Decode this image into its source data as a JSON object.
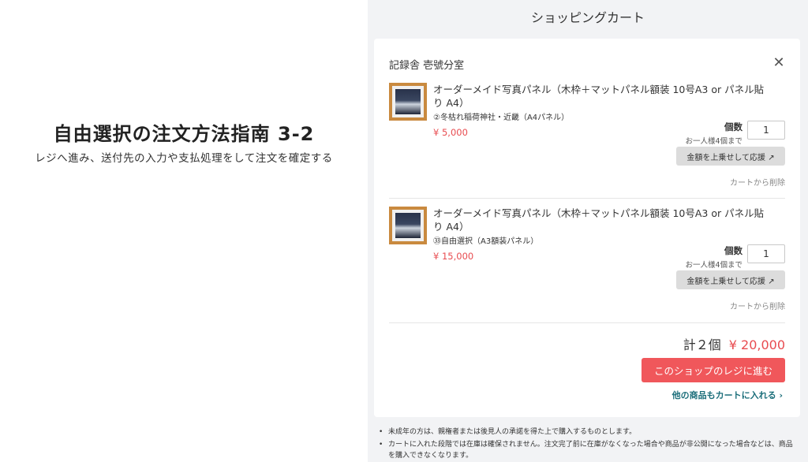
{
  "intro": {
    "headline": "自由選択の注文方法指南 3-2",
    "subtitle": "レジへ進み、送付先の入力や支払処理をして注文を確定する"
  },
  "cart": {
    "title": "ショッピングカート",
    "shop_name": "記録舎 壱號分室",
    "close_icon": "close-icon",
    "items": [
      {
        "name": "オーダーメイド写真パネル（木枠＋マットパネル額装 10号A3 or パネル貼り A4）",
        "variant": "②冬枯れ稲荷神社・近畿（A4パネル）",
        "price": "¥ 5,000",
        "qty_label": "個数",
        "qty_limit": "お一人様4個まで",
        "qty_value": "1",
        "boost_label": "金額を上乗せして応援 ↗",
        "remove_label": "カートから削除"
      },
      {
        "name": "オーダーメイド写真パネル（木枠＋マットパネル額装 10号A3 or パネル貼り A4）",
        "variant": "㉝自由選択（A3額装パネル）",
        "price": "¥ 15,000",
        "qty_label": "個数",
        "qty_limit": "お一人様4個まで",
        "qty_value": "1",
        "boost_label": "金額を上乗せして応援 ↗",
        "remove_label": "カートから削除"
      }
    ],
    "total_count": "計２個",
    "total_price": "¥ 20,000",
    "checkout_label": "このショップのレジに進む",
    "continue_label": "他の商品もカートに入れる ›",
    "notes": [
      "未成年の方は、親権者または後見人の承諾を得た上で購入するものとします。",
      "カートに入れた段階では在庫は確保されません。注文完了前に在庫がなくなった場合や商品が非公開になった場合などは、商品を購入できなくなります。"
    ],
    "colors": {
      "accent": "#f0575b",
      "price": "#e84c50",
      "link": "#1b6e7a"
    }
  }
}
